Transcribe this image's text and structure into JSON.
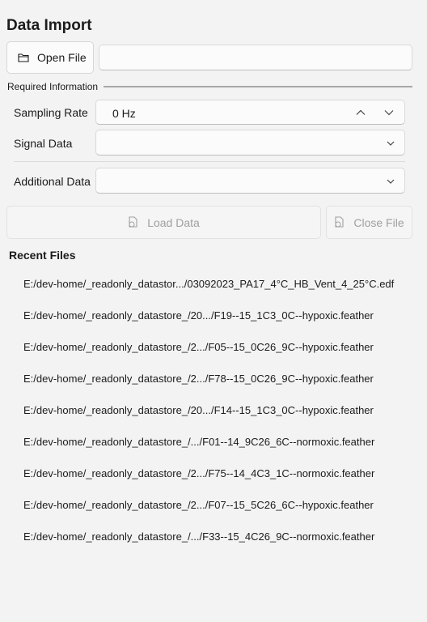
{
  "header": {
    "title": "Data Import"
  },
  "toolbar": {
    "open_file_label": "Open File",
    "file_path_value": ""
  },
  "required": {
    "section_label": "Required Information",
    "sampling_rate_label": "Sampling Rate",
    "sampling_rate_value": "0 Hz",
    "signal_data_label": "Signal Data",
    "signal_data_value": "",
    "additional_data_label": "Additional Data",
    "additional_data_value": ""
  },
  "actions": {
    "load_data_label": "Load Data",
    "close_file_label": "Close File"
  },
  "recent": {
    "title": "Recent Files",
    "items": [
      "E:/dev-home/_readonly_datastor.../03092023_PA17_4°C_HB_Vent_4_25°C.edf",
      "E:/dev-home/_readonly_datastore_/20.../F19--15_1C3_0C--hypoxic.feather",
      "E:/dev-home/_readonly_datastore_/2.../F05--15_0C26_9C--hypoxic.feather",
      "E:/dev-home/_readonly_datastore_/2.../F78--15_0C26_9C--hypoxic.feather",
      "E:/dev-home/_readonly_datastore_/20.../F14--15_1C3_0C--hypoxic.feather",
      "E:/dev-home/_readonly_datastore_/.../F01--14_9C26_6C--normoxic.feather",
      "E:/dev-home/_readonly_datastore_/2.../F75--14_4C3_1C--normoxic.feather",
      "E:/dev-home/_readonly_datastore_/2.../F07--15_5C26_6C--hypoxic.feather",
      "E:/dev-home/_readonly_datastore_/.../F33--15_4C26_9C--normoxic.feather"
    ]
  },
  "icons": {
    "folder": "folder-icon",
    "chevron_up": "chevron-up-icon",
    "chevron_down": "chevron-down-icon",
    "document": "document-icon"
  },
  "colors": {
    "background": "#f3f3f3",
    "disabled_text": "#a0a0a0"
  }
}
